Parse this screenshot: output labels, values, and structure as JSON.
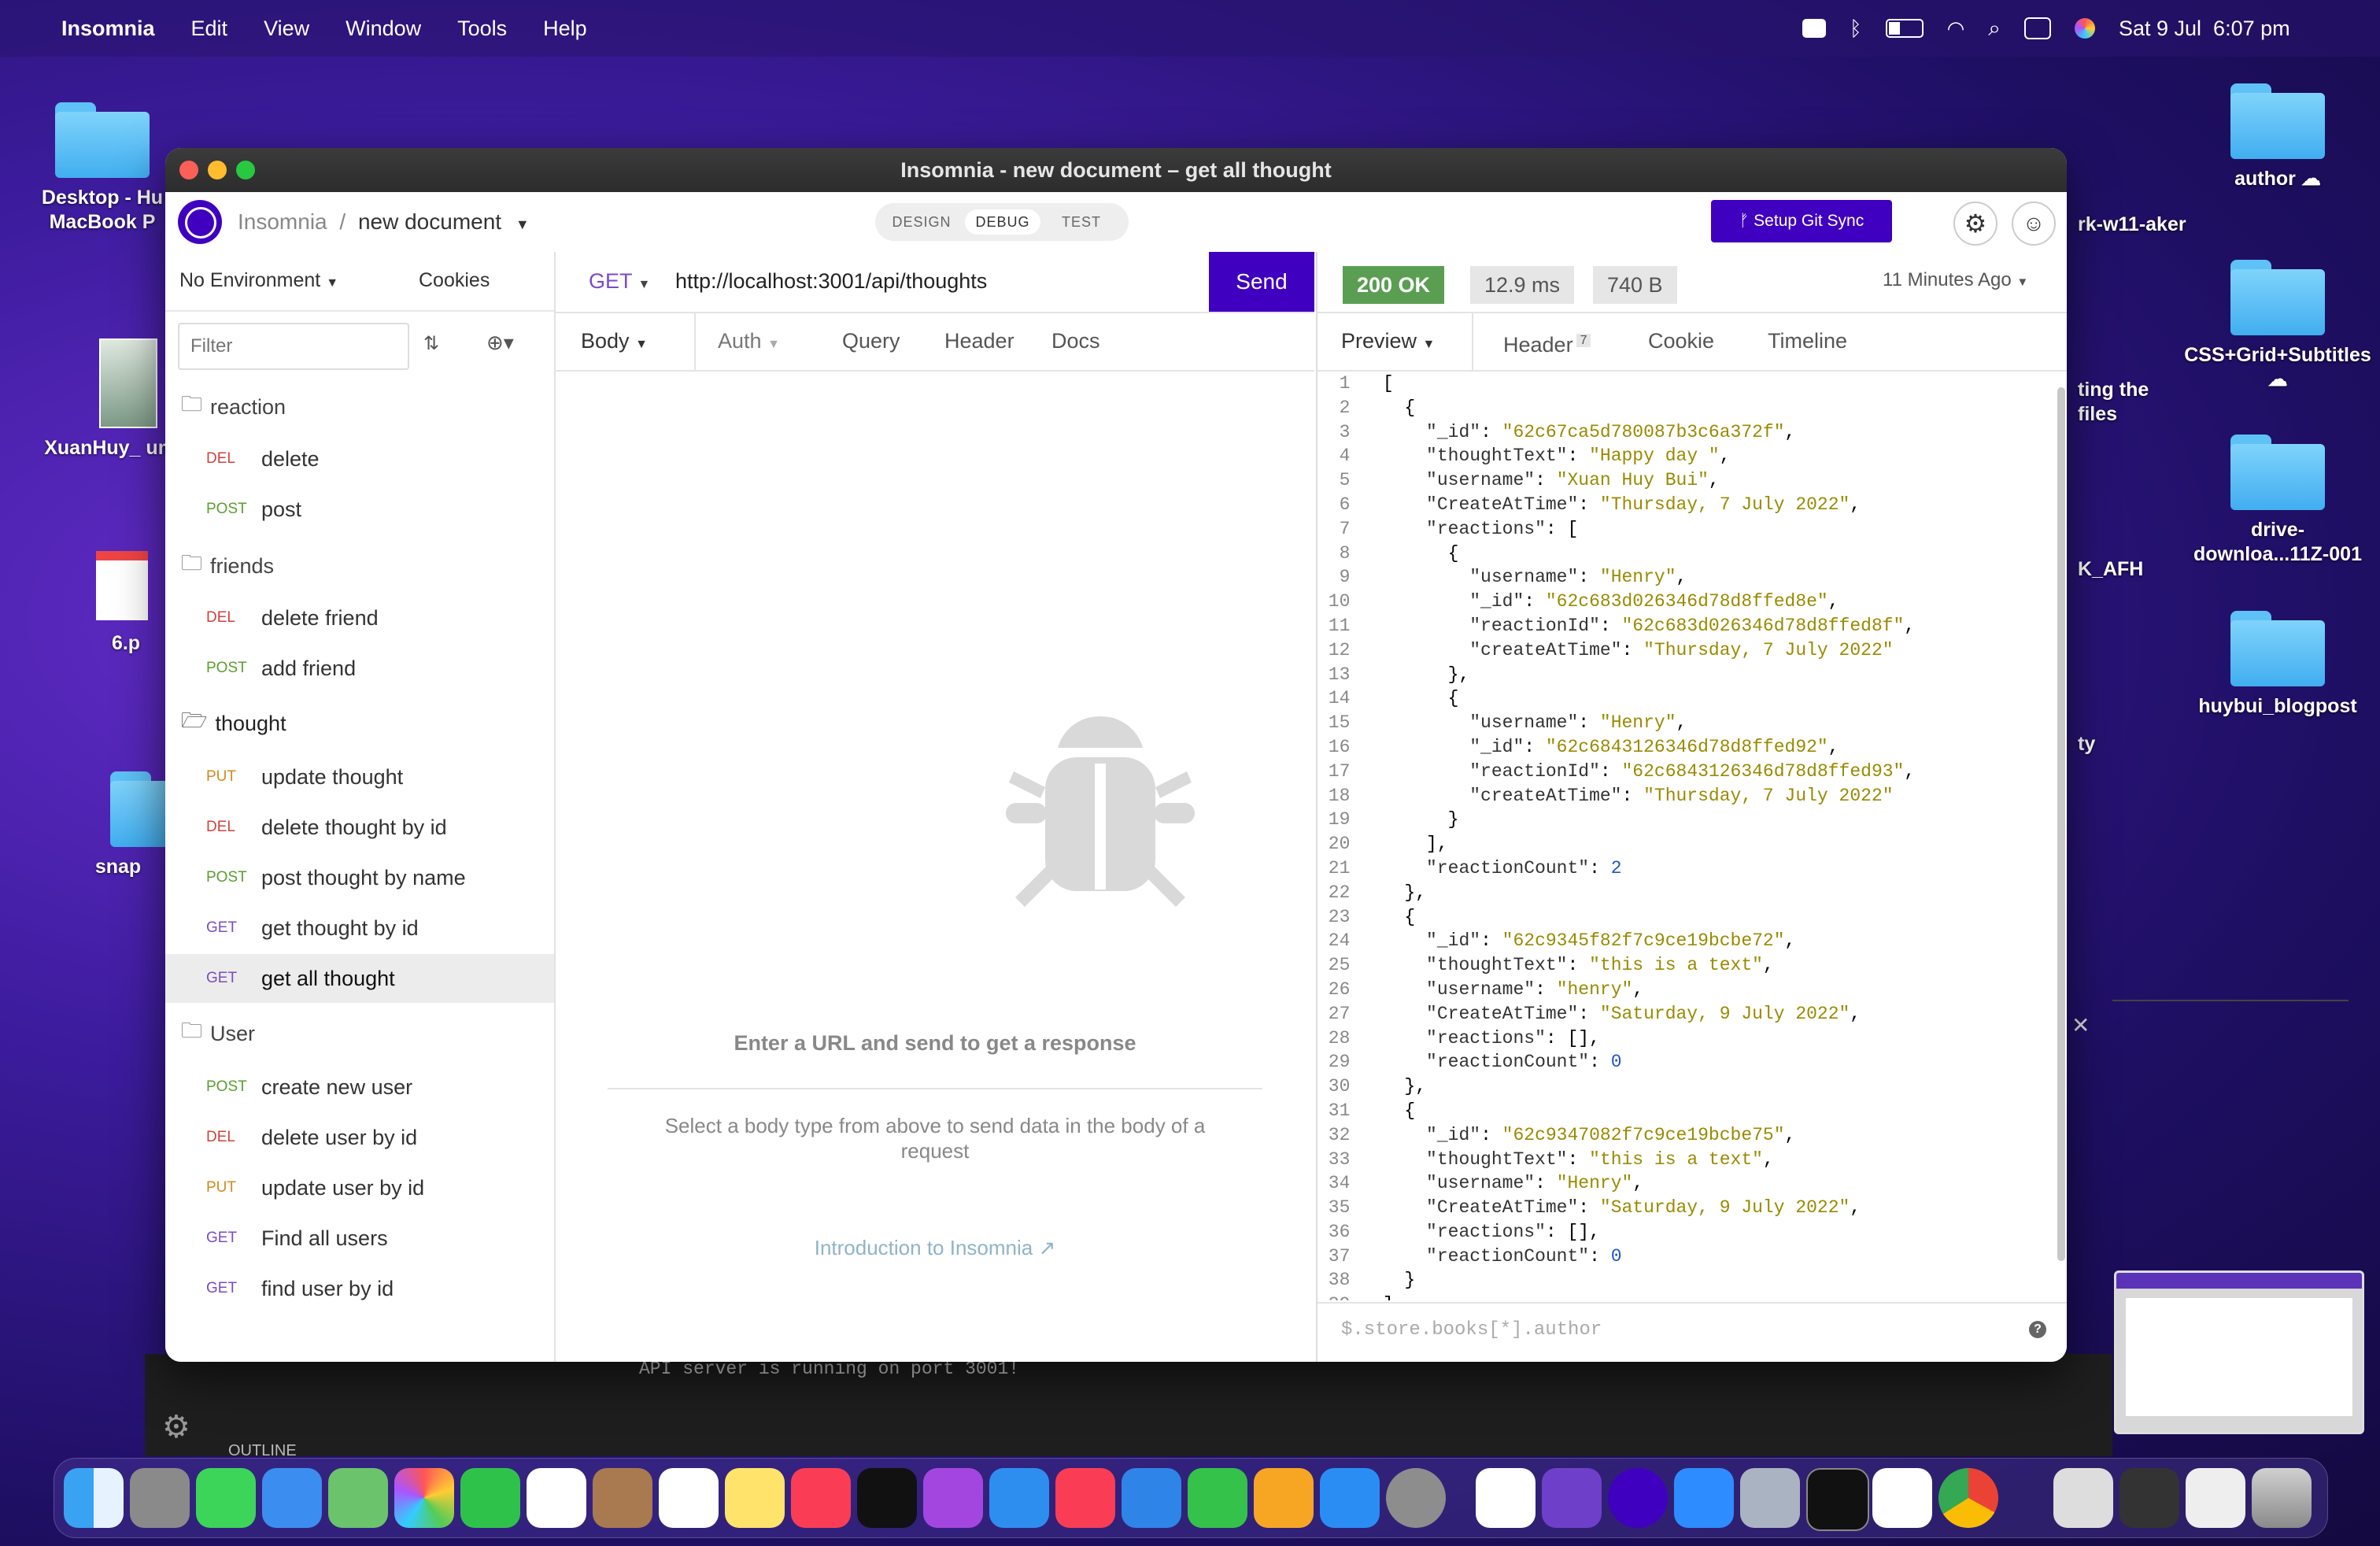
{
  "menubar": {
    "app_name": "Insomnia",
    "items": [
      "Edit",
      "View",
      "Window",
      "Tools",
      "Help"
    ],
    "datetime": "Sat 9 Jul  6:07 pm"
  },
  "desktop": {
    "left_icons": [
      "Desktop - Hu MacBook P",
      "XuanHuy_ ume.",
      "6.p",
      "snap"
    ],
    "right_icons": [
      "author",
      "CSS+Grid+Subtitles",
      "drive-downloa...11Z-001",
      "huybui_blogpost"
    ],
    "partial_icons": [
      "rk-w11-aker",
      "ting the files",
      "K_AFH",
      "ty"
    ]
  },
  "window": {
    "title": "Insomnia - new document – get all thought",
    "breadcrumb_root": "Insomnia",
    "breadcrumb_sep": "/",
    "document_name": "new document",
    "modes": [
      "DESIGN",
      "DEBUG",
      "TEST"
    ],
    "active_mode": "DEBUG",
    "git_sync_label": "Setup Git Sync"
  },
  "sidebar": {
    "environment": "No Environment",
    "cookies": "Cookies",
    "filter_placeholder": "Filter",
    "groups": [
      {
        "name": "reaction",
        "items": [
          {
            "method": "DEL",
            "label": "delete"
          },
          {
            "method": "POST",
            "label": "post"
          }
        ]
      },
      {
        "name": "friends",
        "items": [
          {
            "method": "DEL",
            "label": "delete friend"
          },
          {
            "method": "POST",
            "label": "add friend"
          }
        ]
      },
      {
        "name": "thought",
        "items": [
          {
            "method": "PUT",
            "label": "update thought"
          },
          {
            "method": "DEL",
            "label": "delete thought by id"
          },
          {
            "method": "POST",
            "label": "post thought by name"
          },
          {
            "method": "GET",
            "label": "get thought by id"
          },
          {
            "method": "GET",
            "label": "get all thought"
          }
        ]
      },
      {
        "name": "User",
        "items": [
          {
            "method": "POST",
            "label": "create new user"
          },
          {
            "method": "DEL",
            "label": "delete user by id"
          },
          {
            "method": "PUT",
            "label": "update user by id"
          },
          {
            "method": "GET",
            "label": "Find all users"
          },
          {
            "method": "GET",
            "label": "find user by id"
          }
        ]
      }
    ],
    "method_colors": {
      "GET": "#7b4bc4",
      "POST": "#5a9e30",
      "DEL": "#d0423c",
      "PUT": "#d08a1a"
    }
  },
  "request": {
    "method": "GET",
    "url": "http://localhost:3001/api/thoughts",
    "send_label": "Send",
    "tabs": [
      "Body",
      "Auth",
      "Query",
      "Header",
      "Docs"
    ],
    "empty_title": "Enter a URL and send to get a response",
    "empty_desc": "Select a body type from above to send data in the body of a request",
    "intro_link": "Introduction to Insomnia"
  },
  "response": {
    "status": "200 OK",
    "time": "12.9 ms",
    "size": "740 B",
    "age": "11 Minutes Ago",
    "tabs": [
      "Preview",
      "Header",
      "Cookie",
      "Timeline"
    ],
    "header_count": "7",
    "filter_placeholder": "$.store.books[*].author",
    "lines": [
      "[",
      "  {",
      "    \"_id\": \"62c67ca5d780087b3c6a372f\",",
      "    \"thoughtText\": \"Happy day \",",
      "    \"username\": \"Xuan Huy Bui\",",
      "    \"CreateAtTime\": \"Thursday, 7 July 2022\",",
      "    \"reactions\": [",
      "      {",
      "        \"username\": \"Henry\",",
      "        \"_id\": \"62c683d026346d78d8ffed8e\",",
      "        \"reactionId\": \"62c683d026346d78d8ffed8f\",",
      "        \"createAtTime\": \"Thursday, 7 July 2022\"",
      "      },",
      "      {",
      "        \"username\": \"Henry\",",
      "        \"_id\": \"62c6843126346d78d8ffed92\",",
      "        \"reactionId\": \"62c6843126346d78d8ffed93\",",
      "        \"createAtTime\": \"Thursday, 7 July 2022\"",
      "      }",
      "    ],",
      "    \"reactionCount\": 2",
      "  },",
      "  {",
      "    \"_id\": \"62c9345f82f7c9ce19bcbe72\",",
      "    \"thoughtText\": \"this is a text\",",
      "    \"username\": \"henry\",",
      "    \"CreateAtTime\": \"Saturday, 9 July 2022\",",
      "    \"reactions\": [],",
      "    \"reactionCount\": 0",
      "  },",
      "  {",
      "    \"_id\": \"62c9347082f7c9ce19bcbe75\",",
      "    \"thoughtText\": \"this is a text\",",
      "    \"username\": \"Henry\",",
      "    \"CreateAtTime\": \"Saturday, 9 July 2022\",",
      "    \"reactions\": [],",
      "    \"reactionCount\": 0",
      "  }",
      "]"
    ]
  },
  "terminal": {
    "line": "API server is running on port 3001!",
    "outline_label": "OUTLINE"
  }
}
